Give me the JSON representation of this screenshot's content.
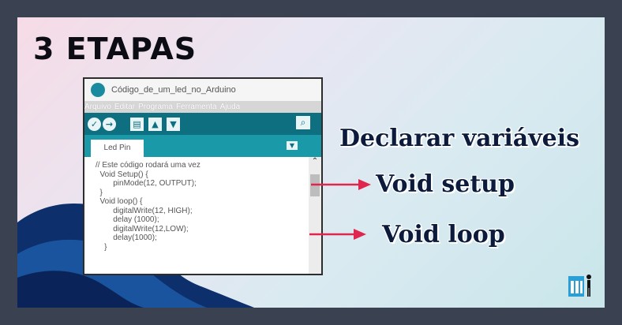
{
  "slide": {
    "title": "3 ETAPAS",
    "labels": [
      "Declarar variáveis",
      "Void setup",
      "Void loop"
    ]
  },
  "editor": {
    "window_title": "Código_de_um_led_no_Arduino",
    "menu": [
      "Arquivo",
      "Editar",
      "Programa",
      "Ferramenta",
      "Ajuda"
    ],
    "toolbar_icons": [
      "verify-icon",
      "upload-icon",
      "new-file-icon",
      "open-icon",
      "save-icon",
      "serial-monitor-icon"
    ],
    "tab_label": "Led Pin",
    "code_lines": [
      "// Este código rodará uma vez",
      "  Void Setup() {",
      "        pinMode(12, OUTPUT);",
      "  }",
      "  Void loop() {",
      "        digitalWrite(12, HIGH);",
      "        delay (1000);",
      "        digitalWrite(12,LOW);",
      "        delay(1000);",
      "    }"
    ]
  },
  "colors": {
    "frame": "#3a4150",
    "toolbar": "#0e6f80",
    "tabbar": "#1a9aa8",
    "arrow": "#e0264f",
    "label_text": "#0c1a3c",
    "wave_dark": "#0d2f6b"
  }
}
